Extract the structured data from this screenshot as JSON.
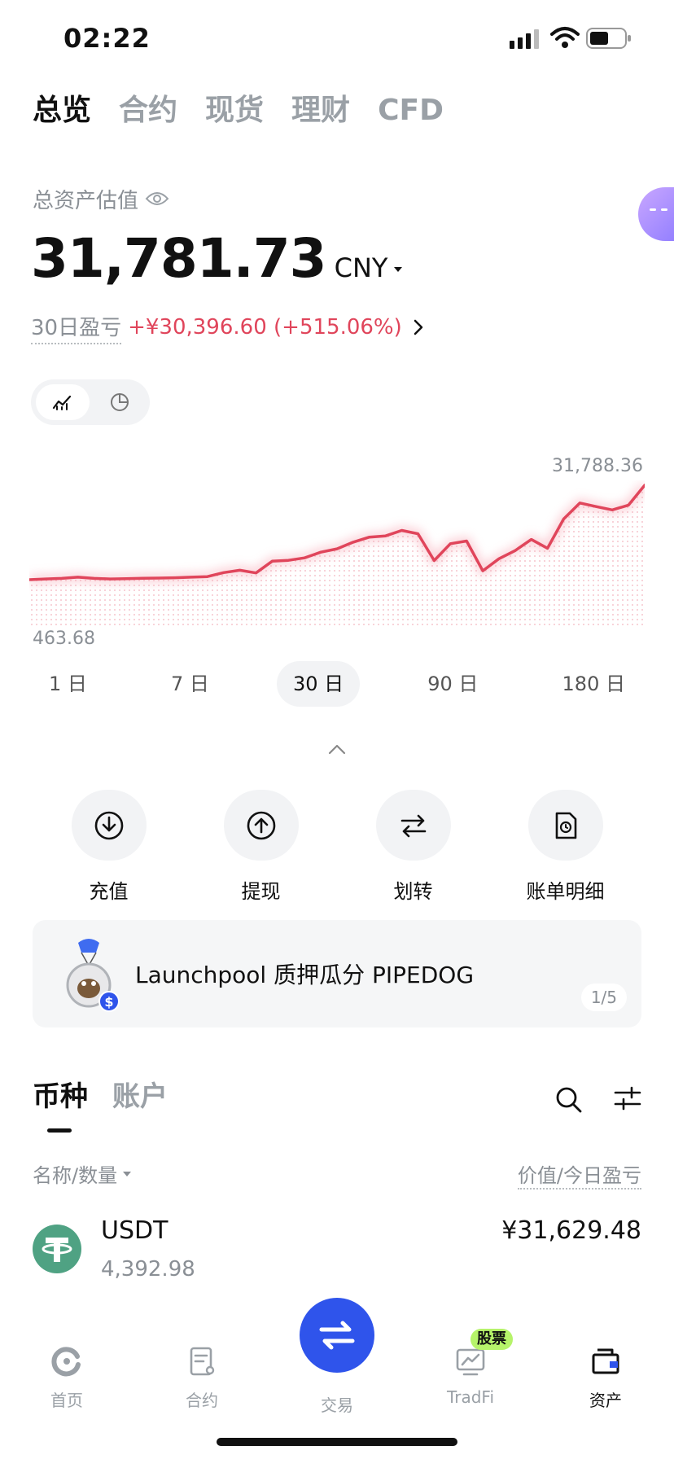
{
  "status_bar": {
    "time": "02:22"
  },
  "top_tabs": [
    {
      "label": "总览",
      "active": true
    },
    {
      "label": "合约",
      "active": false
    },
    {
      "label": "现货",
      "active": false
    },
    {
      "label": "理财",
      "active": false
    },
    {
      "label": "CFD",
      "active": false
    }
  ],
  "assets": {
    "label": "总资产估值",
    "value": "31,781.73",
    "currency": "CNY",
    "pnl_label": "30日盈亏",
    "pnl_value": "+¥30,396.60 (+515.06%)"
  },
  "chart_data": {
    "type": "line",
    "max_label": "31,788.36",
    "min_label": "463.68",
    "ylim": [
      463.68,
      31788.36
    ],
    "values": [
      463.68,
      700,
      900,
      1300,
      900,
      700,
      800,
      950,
      1000,
      1100,
      1300,
      1500,
      2800,
      3600,
      2700,
      6600,
      6900,
      7700,
      9600,
      10700,
      12900,
      14600,
      15000,
      16800,
      15700,
      6800,
      12400,
      13300,
      3400,
      7400,
      10100,
      13800,
      10900,
      20600,
      25900,
      24700,
      23600,
      25200,
      31788.36
    ],
    "color": "#e0455b"
  },
  "range_tabs": [
    {
      "label": "1 日",
      "active": false
    },
    {
      "label": "7 日",
      "active": false
    },
    {
      "label": "30 日",
      "active": true
    },
    {
      "label": "90 日",
      "active": false
    },
    {
      "label": "180 日",
      "active": false
    }
  ],
  "actions": [
    {
      "label": "充值",
      "icon": "deposit-icon"
    },
    {
      "label": "提现",
      "icon": "withdraw-icon"
    },
    {
      "label": "划转",
      "icon": "transfer-icon"
    },
    {
      "label": "账单明细",
      "icon": "bill-icon"
    }
  ],
  "banner": {
    "text": "Launchpool 质押瓜分 PIPEDOG",
    "pager": "1/5"
  },
  "list_tabs": [
    {
      "label": "币种",
      "active": true
    },
    {
      "label": "账户",
      "active": false
    }
  ],
  "list_header": {
    "left": "名称/数量",
    "right": "价值/今日盈亏"
  },
  "holdings": [
    {
      "name": "USDT",
      "quantity": "4,392.98",
      "value": "¥31,629.48",
      "logo_color": "#4fa283"
    }
  ],
  "bottom_nav": [
    {
      "label": "首页",
      "icon": "home-icon"
    },
    {
      "label": "合约",
      "icon": "contract-icon"
    },
    {
      "label": "交易",
      "icon": "trade-icon"
    },
    {
      "label": "TradFi",
      "icon": "tradfi-icon",
      "badge": "股票"
    },
    {
      "label": "资产",
      "icon": "wallet-icon",
      "active": true
    }
  ],
  "colors": {
    "accent": "#2f54eb",
    "loss_gain": "#e0455b",
    "badge": "#b6f36a"
  }
}
